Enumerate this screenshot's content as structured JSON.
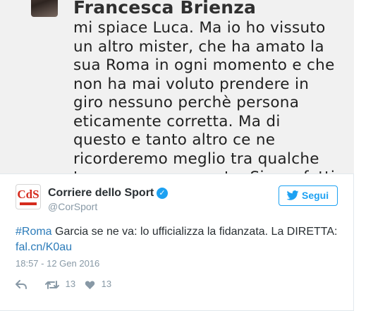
{
  "embedded_screenshot": {
    "name": "Francesca Brienza",
    "text": "mi spiace Luca. Ma io ho vissuto\nun altro mister, che ha amato la\nsua Roma in ogni momento e che\nnon ha mai voluto prendere in\ngiro nessuno perchè persona\neticamente corretta. Ma di\nquesto e tanto altro ce ne\nricorderemo meglio tra qualche\ntempo, ne sono certa. Siamo fatti\ncosì!!! Ora onore a chi verrà."
  },
  "author": {
    "logo_text": "CdS",
    "name": "Corriere dello Sport",
    "handle": "@CorSport",
    "verified_icon": "verified-badge-icon"
  },
  "follow_button": {
    "label": "Segui",
    "icon": "twitter-bird-icon"
  },
  "tweet": {
    "hashtag": "#Roma",
    "text_main": " Garcia se ne va: lo ufficializza la fidanzata. La DIRETTA: ",
    "link": "fal.cn/K0au",
    "timestamp": "18:57 - 12 Gen 2016"
  },
  "actions": {
    "reply_icon": "reply-icon",
    "retweet_icon": "retweet-icon",
    "retweet_count": "13",
    "like_icon": "heart-icon",
    "like_count": "13"
  },
  "colors": {
    "accent": "#1da1f2",
    "link": "#2b7bb9",
    "muted": "#8899a6",
    "logo_red": "#d52b1e"
  }
}
